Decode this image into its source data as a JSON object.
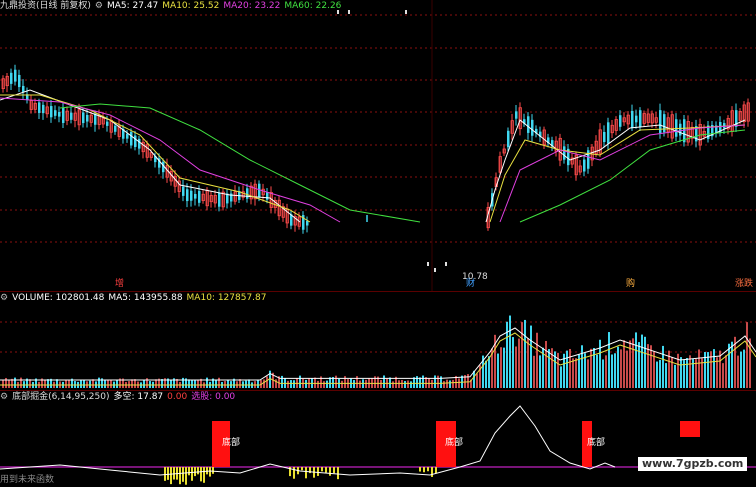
{
  "colors": {
    "up": "#ff4b4b",
    "down": "#40d8f0",
    "ma5": "#ffffff",
    "ma10": "#e8e040",
    "ma20": "#e040e0",
    "ma60": "#40e040",
    "grid": "#8a1010",
    "red_box": "#ff1010",
    "yellow": "#e8e030"
  },
  "main": {
    "title": "九鼎投资(日线 前复权)",
    "ma5": "MA5: 27.47",
    "ma10": "MA10: 25.52",
    "ma20": "MA20: 23.22",
    "ma60": "MA60: 22.26",
    "low_label": "10.78",
    "marks": {
      "zeng": "增",
      "cai": "财",
      "gou": "购",
      "zhangdie": "涨跌"
    }
  },
  "volume": {
    "label": "VOLUME: 102801.48",
    "ma5": "MA5: 143955.88",
    "ma10": "MA10: 127857.87"
  },
  "indicator": {
    "title": "底部掘金(6,14,95,250)",
    "duokong": "多空: 17.87",
    "val1": "0.00",
    "xuangu": "选股: 0.00",
    "box_label": "底部",
    "bottom_text": "用到未来函数",
    "watermark": "www.7gpzb.com"
  }
}
